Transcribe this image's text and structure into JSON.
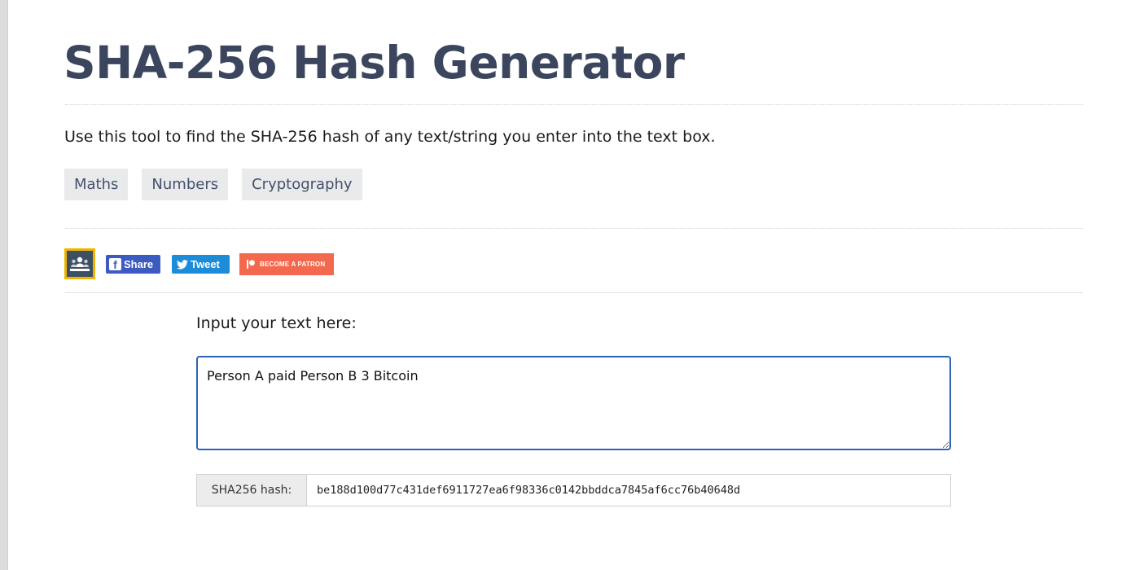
{
  "page": {
    "title": "SHA-256 Hash Generator",
    "description": "Use this tool to find the SHA-256 hash of any text/string you enter into the text box."
  },
  "tags": [
    {
      "label": "Maths"
    },
    {
      "label": "Numbers"
    },
    {
      "label": "Cryptography"
    }
  ],
  "social": {
    "classroom_icon": "google-classroom-icon",
    "facebook_label": "Share",
    "twitter_label": "Tweet",
    "patreon_label": "BECOME A PATRON",
    "colors": {
      "facebook": "#3b5bc0",
      "twitter": "#1c8cd9",
      "patreon": "#f4694d",
      "classroom_border": "#f0b400"
    }
  },
  "tool": {
    "input_label": "Input your text here:",
    "input_value": "Person A paid Person B 3 Bitcoin",
    "hash_label": "SHA256 hash:",
    "hash_value": "be188d100d77c431def6911727ea6f98336c0142bbddca7845af6cc76b40648d"
  },
  "theme": {
    "title_color": "#3b465e",
    "tag_background": "#e9eaec",
    "input_border": "#2d62b6"
  }
}
